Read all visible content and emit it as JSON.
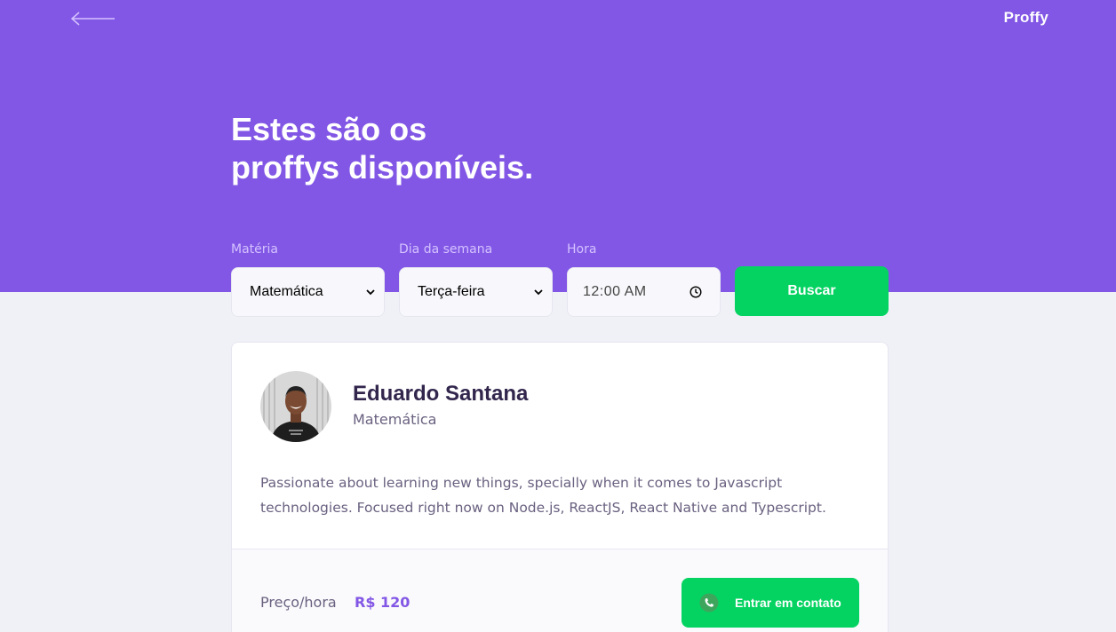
{
  "header": {
    "back_icon": "arrow-left-icon",
    "logo": "Proffy",
    "title_line1": "Estes são os",
    "title_line2": "proffys disponíveis."
  },
  "filters": {
    "subject": {
      "label": "Matéria",
      "value": "Matemática"
    },
    "weekday": {
      "label": "Dia da semana",
      "value": "Terça-feira"
    },
    "time": {
      "label": "Hora",
      "value": "12:00  AM",
      "icon": "clock-icon"
    },
    "search_label": "Buscar"
  },
  "teacher": {
    "name": "Eduardo Santana",
    "subject": "Matemática",
    "bio": "Passionate about learning new things, specially when it comes to Javascript technologies. Focused right now on Node.js, ReactJS, React Native and Typescript.",
    "price_label": "Preço/hora",
    "price_value": "R$ 120",
    "contact_label": "Entrar em contato",
    "contact_icon": "whatsapp-icon"
  },
  "colors": {
    "primary": "#8257e5",
    "secondary": "#04d361",
    "background": "#f0f0f7"
  }
}
